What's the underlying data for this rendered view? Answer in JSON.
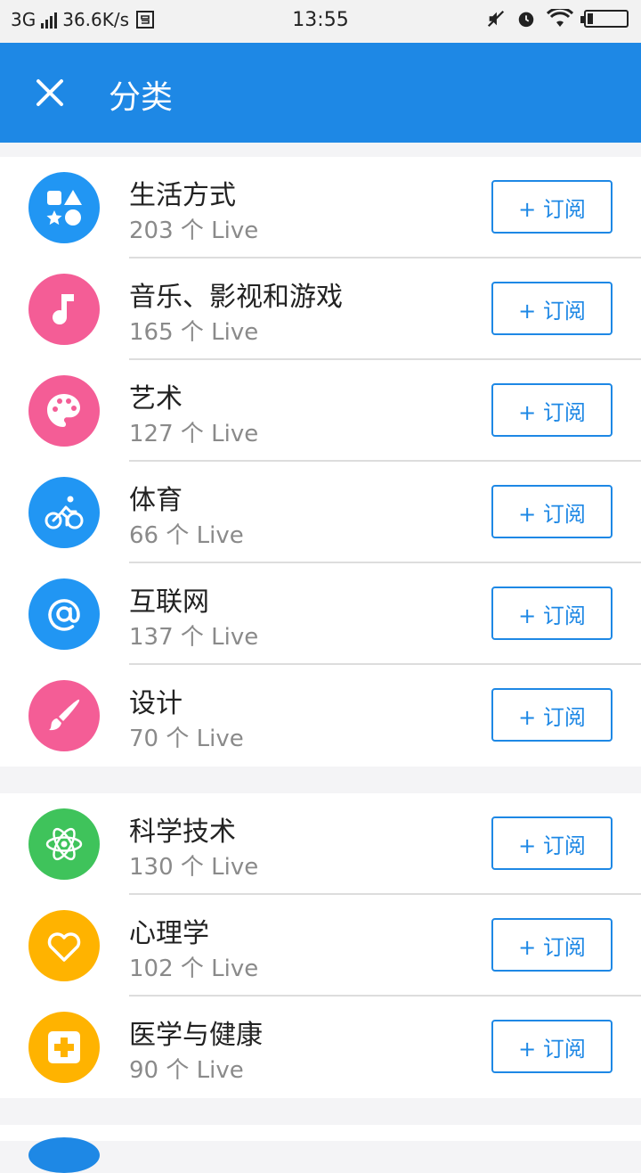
{
  "status_bar": {
    "network": "3G",
    "speed": "36.6K/s",
    "time": "13:55"
  },
  "app_bar": {
    "title": "分类"
  },
  "colors": {
    "primary": "#1e88e5",
    "blue": "#2196f3",
    "pink": "#f45d96",
    "green": "#3fc35b",
    "yellow": "#ffb300"
  },
  "groups": [
    {
      "items": [
        {
          "name": "生活方式",
          "count": "203 个 Live",
          "icon": "shapes-icon",
          "color": "#2196f3",
          "subscribe": "+ 订阅"
        },
        {
          "name": "音乐、影视和游戏",
          "count": "165 个 Live",
          "icon": "music-note-icon",
          "color": "#f45d96",
          "subscribe": "+ 订阅"
        },
        {
          "name": "艺术",
          "count": "127 个 Live",
          "icon": "palette-icon",
          "color": "#f45d96",
          "subscribe": "+ 订阅"
        },
        {
          "name": "体育",
          "count": "66 个 Live",
          "icon": "bicycle-icon",
          "color": "#2196f3",
          "subscribe": "+ 订阅"
        },
        {
          "name": "互联网",
          "count": "137 个 Live",
          "icon": "at-sign-icon",
          "color": "#2196f3",
          "subscribe": "+ 订阅"
        },
        {
          "name": "设计",
          "count": "70 个 Live",
          "icon": "brush-icon",
          "color": "#f45d96",
          "subscribe": "+ 订阅"
        }
      ]
    },
    {
      "items": [
        {
          "name": "科学技术",
          "count": "130 个 Live",
          "icon": "atom-icon",
          "color": "#3fc35b",
          "subscribe": "+ 订阅"
        },
        {
          "name": "心理学",
          "count": "102 个 Live",
          "icon": "heart-icon",
          "color": "#ffb300",
          "subscribe": "+ 订阅"
        },
        {
          "name": "医学与健康",
          "count": "90 个 Live",
          "icon": "medical-cross-icon",
          "color": "#ffb300",
          "subscribe": "+ 订阅"
        }
      ]
    }
  ]
}
